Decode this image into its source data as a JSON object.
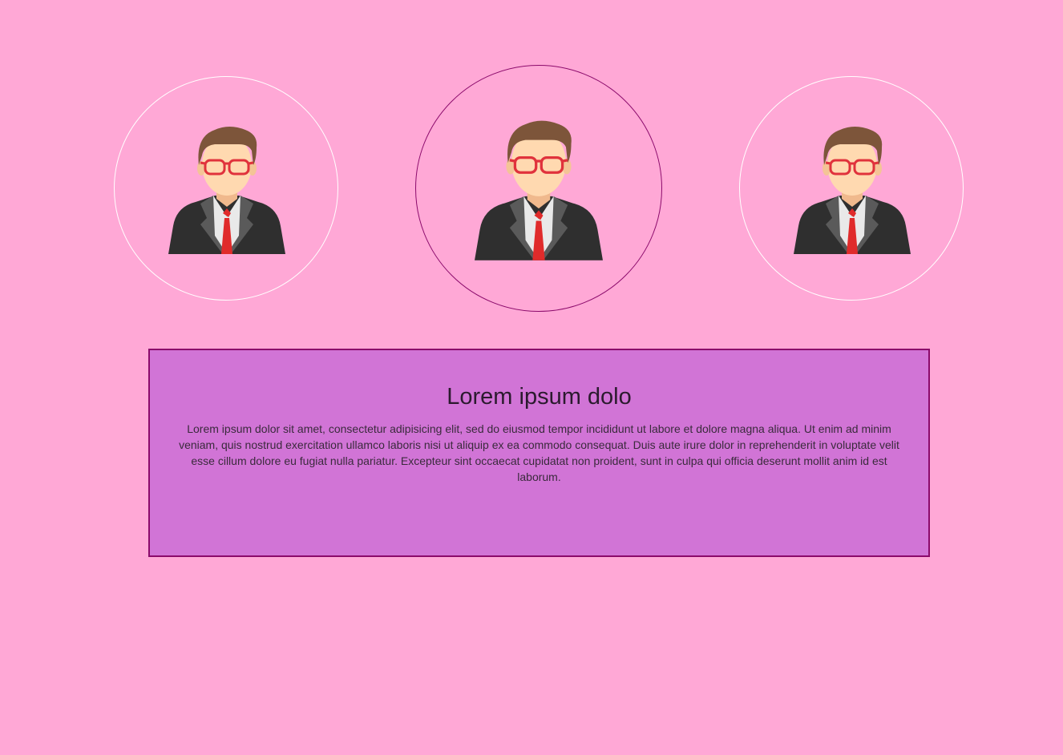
{
  "avatars": [
    {
      "name": "avatar-left",
      "icon": "businessman-avatar-icon",
      "ring_color": "#ffffff"
    },
    {
      "name": "avatar-center",
      "icon": "businessman-avatar-icon",
      "ring_color": "#8b0a6b"
    },
    {
      "name": "avatar-right",
      "icon": "businessman-avatar-icon",
      "ring_color": "#ffffff"
    }
  ],
  "panel": {
    "title": "Lorem ipsum dolo",
    "body": "Lorem ipsum dolor sit amet, consectetur adipisicing elit, sed do eiusmod tempor incididunt ut labore et dolore magna aliqua. Ut enim ad minim veniam, quis nostrud exercitation ullamco laboris nisi ut aliquip ex ea commodo consequat. Duis aute irure dolor in reprehenderit in voluptate velit esse cillum dolore eu fugiat nulla pariatur. Excepteur sint occaecat cupidatat non proident, sunt in culpa qui officia deserunt mollit anim id est laborum."
  },
  "colors": {
    "background": "#ffa8d6",
    "panel_fill": "#d174d6",
    "panel_border": "#8b0a6b",
    "ring_active": "#8b0a6b",
    "ring_inactive": "#ffffff"
  }
}
